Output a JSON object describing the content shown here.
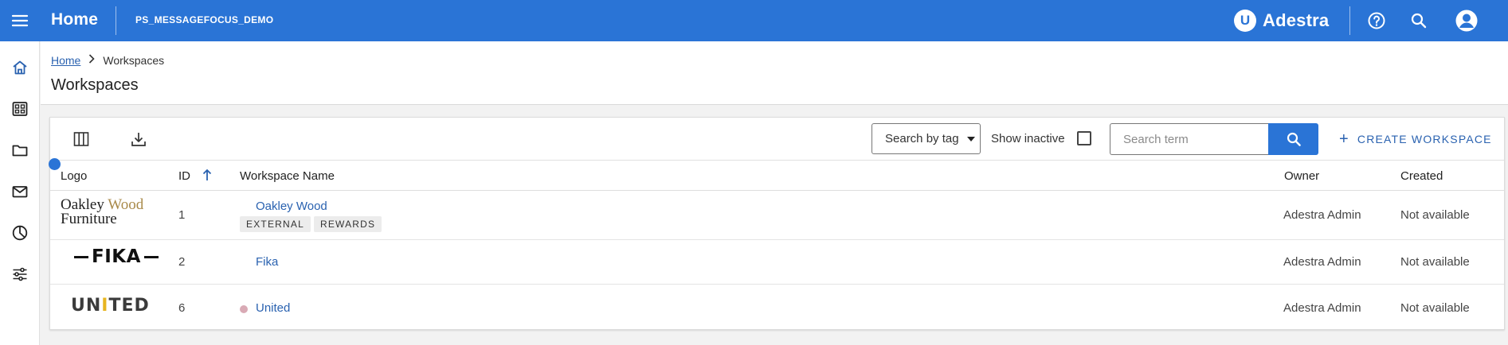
{
  "topbar": {
    "title": "Home",
    "account": "PS_MESSAGEFOCUS_DEMO",
    "brand_mark": "U",
    "brand_name": "Adestra",
    "icons": [
      "menu-icon",
      "help-icon",
      "search-icon",
      "account-icon"
    ],
    "bg_color": "#2a74d6"
  },
  "sidebar": {
    "items": [
      {
        "icon": "home-icon"
      },
      {
        "icon": "dashboard-icon"
      },
      {
        "icon": "folder-icon"
      },
      {
        "icon": "mail-icon"
      },
      {
        "icon": "reports-icon"
      },
      {
        "icon": "settings-sliders-icon"
      }
    ]
  },
  "breadcrumb": {
    "home": "Home",
    "current": "Workspaces"
  },
  "page": {
    "title": "Workspaces"
  },
  "toolbar": {
    "columns_icon": "columns-icon",
    "download_icon": "download-icon",
    "tag_select": "Search by tag",
    "show_inactive": "Show inactive",
    "show_inactive_checked": false,
    "search_placeholder": "Search term",
    "create_label": "CREATE WORKSPACE",
    "create_plus": "+"
  },
  "table": {
    "columns": {
      "logo": "Logo",
      "id": "ID",
      "name": "Workspace Name",
      "owner": "Owner",
      "created": "Created"
    },
    "sort": {
      "column": "ID",
      "direction": "ascending"
    },
    "rows": [
      {
        "logo_text_1": "Oakley",
        "logo_text_2": "Wood",
        "logo_text_3": "Furniture",
        "id": "1",
        "name": "Oakley Wood",
        "tags": [
          "EXTERNAL",
          "REWARDS"
        ],
        "owner": "Adestra Admin",
        "created": "Not available",
        "inactive": false
      },
      {
        "logo_text_1": "FIKA",
        "id": "2",
        "name": "Fika",
        "tags": [],
        "owner": "Adestra Admin",
        "created": "Not available",
        "inactive": false
      },
      {
        "logo_text_1": "UN",
        "logo_text_2": "I",
        "logo_text_3": "TED",
        "id": "6",
        "name": "United",
        "tags": [],
        "owner": "Adestra Admin",
        "created": "Not available",
        "inactive": true
      }
    ]
  }
}
